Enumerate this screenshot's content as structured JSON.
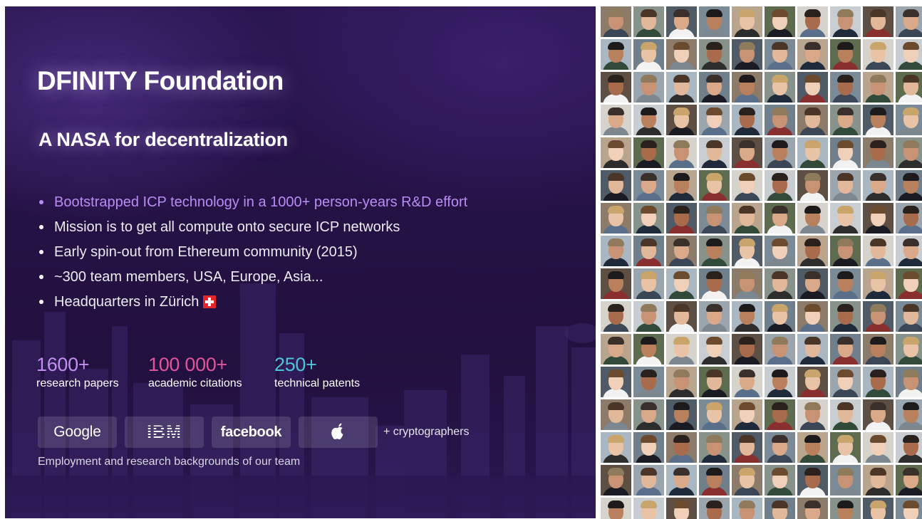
{
  "slide": {
    "title": "DFINITY Foundation",
    "subtitle": "A NASA for decentralization",
    "bullets": [
      {
        "text": "Bootstrapped ICP technology in a 1000+ person-years R&D effort",
        "highlight": true
      },
      {
        "text": "Mission is to get all compute onto secure ICP networks",
        "highlight": false
      },
      {
        "text": "Early spin-out from Ethereum community (2015)",
        "highlight": false
      },
      {
        "text": "~300 team members, USA, Europe, Asia...",
        "highlight": false
      },
      {
        "text": "Headquarters in Zürich",
        "highlight": false,
        "icon": "swiss-flag-icon"
      }
    ],
    "stats": [
      {
        "number": "1600+",
        "label": "research papers",
        "color": "#c28ef0"
      },
      {
        "number": "100 000+",
        "label": "academic citations",
        "color": "#e0559a"
      },
      {
        "number": "250+",
        "label": "technical patents",
        "color": "#4ec3d9"
      }
    ],
    "logos": [
      {
        "text": "Google",
        "icon": "google-logo"
      },
      {
        "text": "IBM",
        "icon": "ibm-logo"
      },
      {
        "text": "facebook",
        "icon": "facebook-logo"
      },
      {
        "text": "",
        "icon": "apple-logo"
      }
    ],
    "crypto_label": "+ cryptographers",
    "caption": "Employment and research backgrounds of our team"
  },
  "colors": {
    "accent_purple": "#b98cf5",
    "slide_background": "#251245"
  },
  "team_grid": {
    "columns": 10,
    "rows": 16,
    "description_icon": "team-member-photo"
  }
}
